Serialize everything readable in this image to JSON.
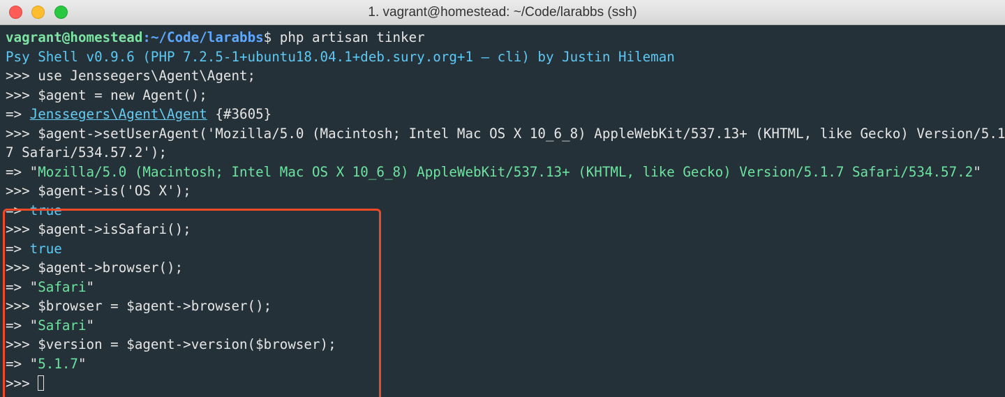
{
  "window": {
    "title": "1. vagrant@homestead: ~/Code/larabbs (ssh)"
  },
  "terminal": {
    "prompt_user": "vagrant@homestead",
    "prompt_path": ":~/Code/larabbs",
    "prompt_symbol": "$ ",
    "command": "php artisan tinker",
    "psy_banner": "Psy Shell v0.9.6 (PHP 7.2.5-1+ubuntu18.04.1+deb.sury.org+1 — cli) by Justin Hileman",
    "line_use": ">>> use Jenssegers\\Agent\\Agent;",
    "line_new": ">>> $agent = new Agent();",
    "out_arrow": "=> ",
    "out_class": "Jenssegers\\Agent\\Agent",
    "out_class_id": " {#3605}",
    "line_setua_1": ">>> $agent->setUserAgent('Mozilla/5.0 (Macintosh; Intel Mac OS X 10_6_8) AppleWebKit/537.13+ (KHTML, like Gecko) Version/5.1.",
    "line_setua_2": "7 Safari/534.57.2');",
    "out_ua_quote_open": "\"",
    "out_ua": "Mozilla/5.0 (Macintosh; Intel Mac OS X 10_6_8) AppleWebKit/537.13+ (KHTML, like Gecko) Version/5.1.7 Safari/534.57.2",
    "out_ua_quote_close": "\"",
    "line_is": ">>> $agent->is('OS X');",
    "out_true_1": "true",
    "line_issafari": ">>> $agent->isSafari();",
    "out_true_2": "true",
    "line_browser": ">>> $agent->browser();",
    "out_safari_1": "Safari",
    "line_browser_var": ">>> $browser = $agent->browser();",
    "out_safari_2": "Safari",
    "line_version": ">>> $version = $agent->version($browser);",
    "out_version": "5.1.7",
    "final_prompt": ">>> "
  },
  "colors": {
    "background": "#253139",
    "highlight_border": "#ef4a27"
  }
}
